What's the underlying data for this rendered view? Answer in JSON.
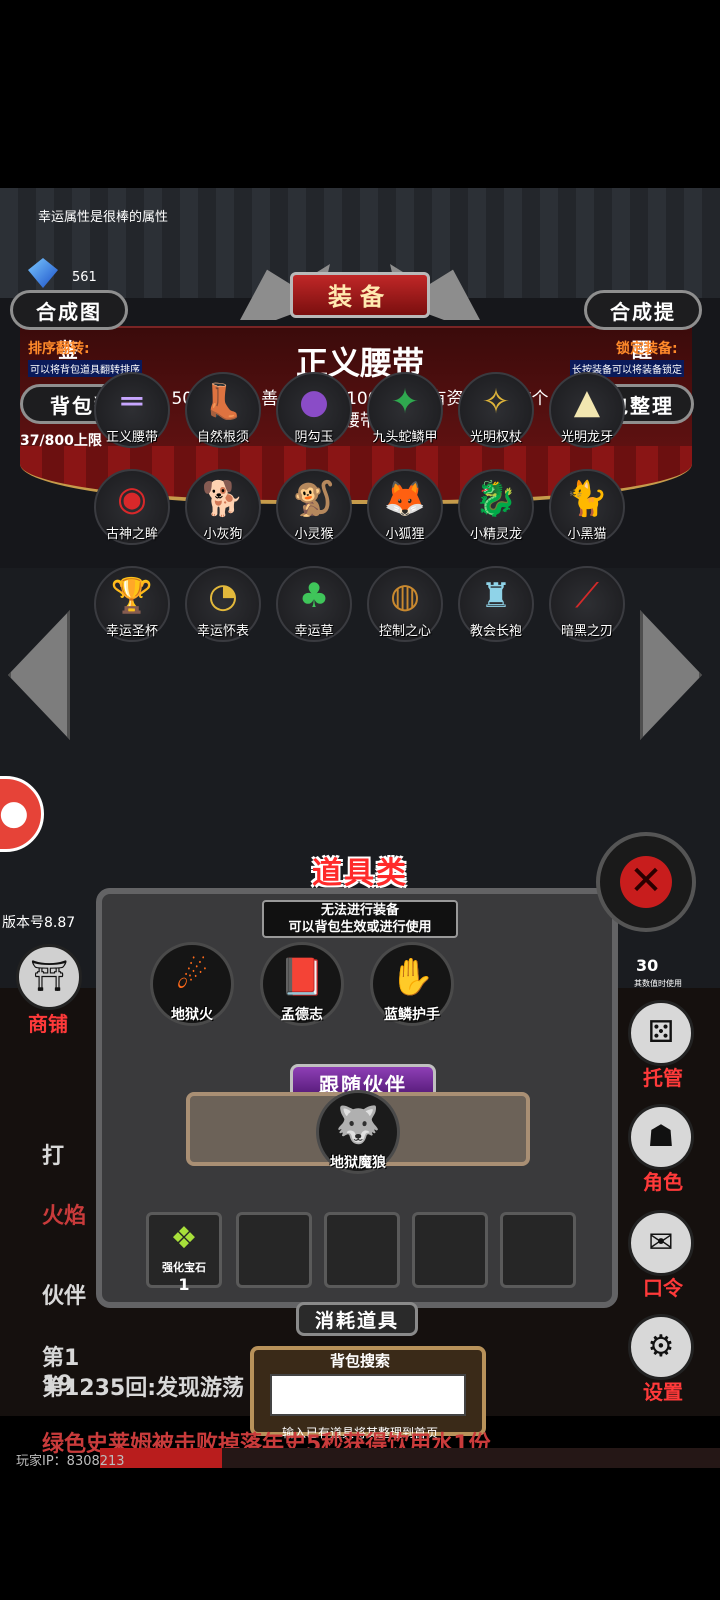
{
  "tip_text": "幸运属性是很棒的属性",
  "gem_count": "561",
  "buttons": {
    "compose_book": "合成图鉴",
    "compose_remind": "合成提醒",
    "bag_flip": "背包翻转",
    "bag_sort": "背包整理",
    "close": "✕"
  },
  "labels": {
    "sort_flip_title": "排序翻转:",
    "sort_flip_desc": "可以将背包道具翻转排序",
    "lock_title": "锁定装备:",
    "lock_desc": "长按装备可以将装备锁定",
    "capacity": "37/800上限"
  },
  "title_tab": "装备",
  "selected_item": {
    "name": "正义腰带",
    "desc": "50层以内，善良要大于100的人才有资格佩戴这个腰带"
  },
  "equipment": [
    {
      "label": "正义腰带",
      "icon": "belt-icon",
      "glyph": "═",
      "color": "#c7a6ff"
    },
    {
      "label": "自然根须",
      "icon": "boots-icon",
      "glyph": "👢",
      "color": "#3aa33a"
    },
    {
      "label": "阴勾玉",
      "icon": "amulet-icon",
      "glyph": "●",
      "color": "#8a4cc7"
    },
    {
      "label": "九头蛇鳞甲",
      "icon": "armor-icon",
      "glyph": "✦",
      "color": "#2fa84f"
    },
    {
      "label": "光明权杖",
      "icon": "scepter-icon",
      "glyph": "✧",
      "color": "#e0b63a"
    },
    {
      "label": "光明龙牙",
      "icon": "fang-icon",
      "glyph": "▲",
      "color": "#f2e6b0"
    },
    {
      "label": "古神之眸",
      "icon": "eye-icon",
      "glyph": "◉",
      "color": "#d8282a"
    },
    {
      "label": "小灰狗",
      "icon": "dog-icon",
      "glyph": "🐕",
      "color": "#9a8f82"
    },
    {
      "label": "小灵猴",
      "icon": "monkey-icon",
      "glyph": "🐒",
      "color": "#e38a2e"
    },
    {
      "label": "小狐狸",
      "icon": "fox-icon",
      "glyph": "🦊",
      "color": "#8a7c6a"
    },
    {
      "label": "小精灵龙",
      "icon": "dragon-icon",
      "glyph": "🐉",
      "color": "#39a84a"
    },
    {
      "label": "小黑猫",
      "icon": "cat-icon",
      "glyph": "🐈",
      "color": "#cfcfcf"
    },
    {
      "label": "幸运圣杯",
      "icon": "grail-icon",
      "glyph": "🏆",
      "color": "#f2f2f2"
    },
    {
      "label": "幸运怀表",
      "icon": "pocket-watch-icon",
      "glyph": "◔",
      "color": "#e2b83b"
    },
    {
      "label": "幸运草",
      "icon": "clover-icon",
      "glyph": "♣",
      "color": "#3fc55a"
    },
    {
      "label": "控制之心",
      "icon": "heart-orb-icon",
      "glyph": "◍",
      "color": "#c9892f"
    },
    {
      "label": "教会长袍",
      "icon": "robe-icon",
      "glyph": "♜",
      "color": "#8fd3e8"
    },
    {
      "label": "暗黑之刃",
      "icon": "blade-icon",
      "glyph": "⟋",
      "color": "#d42a2a"
    }
  ],
  "props_panel": {
    "title": "道具类",
    "sub1": "无法进行装备",
    "sub2": "可以背包生效或进行使用",
    "items": [
      {
        "label": "地狱火",
        "icon": "fireball-icon",
        "glyph": "☄",
        "color": "#ff6a1a"
      },
      {
        "label": "孟德志",
        "icon": "red-book-icon",
        "glyph": "📕",
        "color": "#c81e1e"
      },
      {
        "label": "蓝鳞护手",
        "icon": "gauntlet-icon",
        "glyph": "✋",
        "color": "#4a6ad8"
      }
    ]
  },
  "companion": {
    "tab": "跟随伙伴",
    "name": "地狱魔狼",
    "icon": "hell-wolf-icon",
    "glyph": "🐺",
    "color": "#2fb33a"
  },
  "consumables": {
    "tab": "消耗道具",
    "items": [
      {
        "label": "强化宝石",
        "count": "1",
        "icon": "gem-cluster-icon",
        "glyph": "❖",
        "color": "#a8e03a"
      }
    ]
  },
  "search": {
    "label": "背包搜索",
    "value": "",
    "hint": "输入已有道具将其整理到首页"
  },
  "version": "版本号8.87",
  "side_menu": {
    "shop": "商铺",
    "manage": "托管",
    "role": "角色",
    "password": "口令",
    "settings": "设置",
    "status_value": "30",
    "status_note": "其数值时使用"
  },
  "log": {
    "line1": "打",
    "line2": "火焰",
    "line3": "伙伴",
    "line4": "第1",
    "line5": "19",
    "line6": "第1235回:发现游荡",
    "line7": "绿色史莱姆被击败掉落年史5秒获得饮用水1份"
  },
  "player_id": "玩家IP：8308213",
  "progress": 0.19,
  "colors": {
    "accent_red": "#c81d1d",
    "gold": "#c69b4b",
    "purple": "#8e3fb6"
  }
}
